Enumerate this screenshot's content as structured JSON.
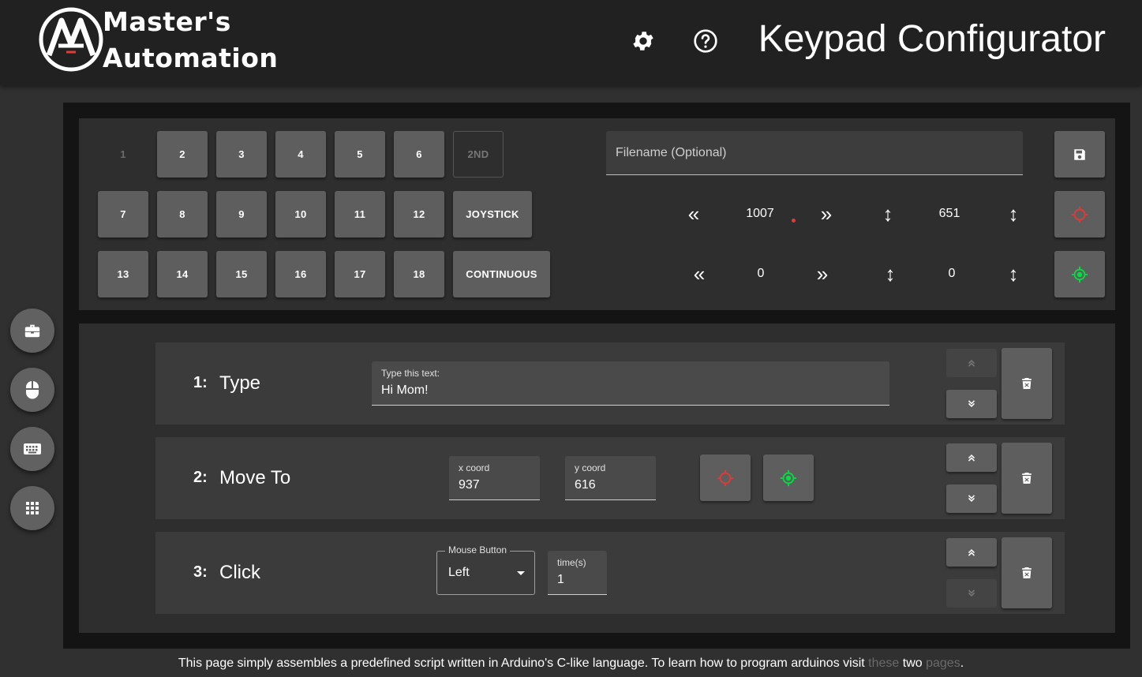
{
  "header": {
    "logo_line1": "Master's",
    "logo_line2": "Automation",
    "title": "Keypad Configurator",
    "settings_icon": "gear-icon",
    "help_icon": "help-circle-icon"
  },
  "sidebar": {
    "buttons": [
      {
        "icon": "toolbox-icon"
      },
      {
        "icon": "mouse-icon"
      },
      {
        "icon": "keyboard-icon"
      },
      {
        "icon": "keypad-grid-icon"
      }
    ]
  },
  "keypad": {
    "row1": [
      "1",
      "2",
      "3",
      "4",
      "5",
      "6",
      "2ND"
    ],
    "row2": [
      "7",
      "8",
      "9",
      "10",
      "11",
      "12",
      "JOYSTICK"
    ],
    "row3": [
      "13",
      "14",
      "15",
      "16",
      "17",
      "18",
      "CONTINUOUS"
    ]
  },
  "file": {
    "placeholder": "Filename (Optional)",
    "save_icon": "floppy-disk-icon"
  },
  "coords": {
    "live": {
      "x": "1007",
      "y": "651"
    },
    "saved": {
      "x": "0",
      "y": "0"
    },
    "left_glyph": "«",
    "right_glyph": "»",
    "vert_glyph": "↕"
  },
  "steps": [
    {
      "num": "1:",
      "title": "Type",
      "field_label": "Type this text:",
      "field_value": "Hi Mom!"
    },
    {
      "num": "2:",
      "title": "Move To",
      "x_label": "x coord",
      "x_value": "937",
      "y_label": "y coord",
      "y_value": "616"
    },
    {
      "num": "3:",
      "title": "Click",
      "select_label": "Mouse Button",
      "select_value": "Left",
      "times_label": "time(s)",
      "times_value": "1"
    }
  ],
  "footer": {
    "text_before": "This page simply assembles a predefined script written in Arduino's C-like language. To learn how to program arduinos visit ",
    "link1": "these",
    "text_middle": " two ",
    "link2": "pages",
    "text_after": "."
  },
  "colors": {
    "target_red": "#e53935",
    "target_green": "#00e040",
    "panel_bg": "#141414"
  }
}
